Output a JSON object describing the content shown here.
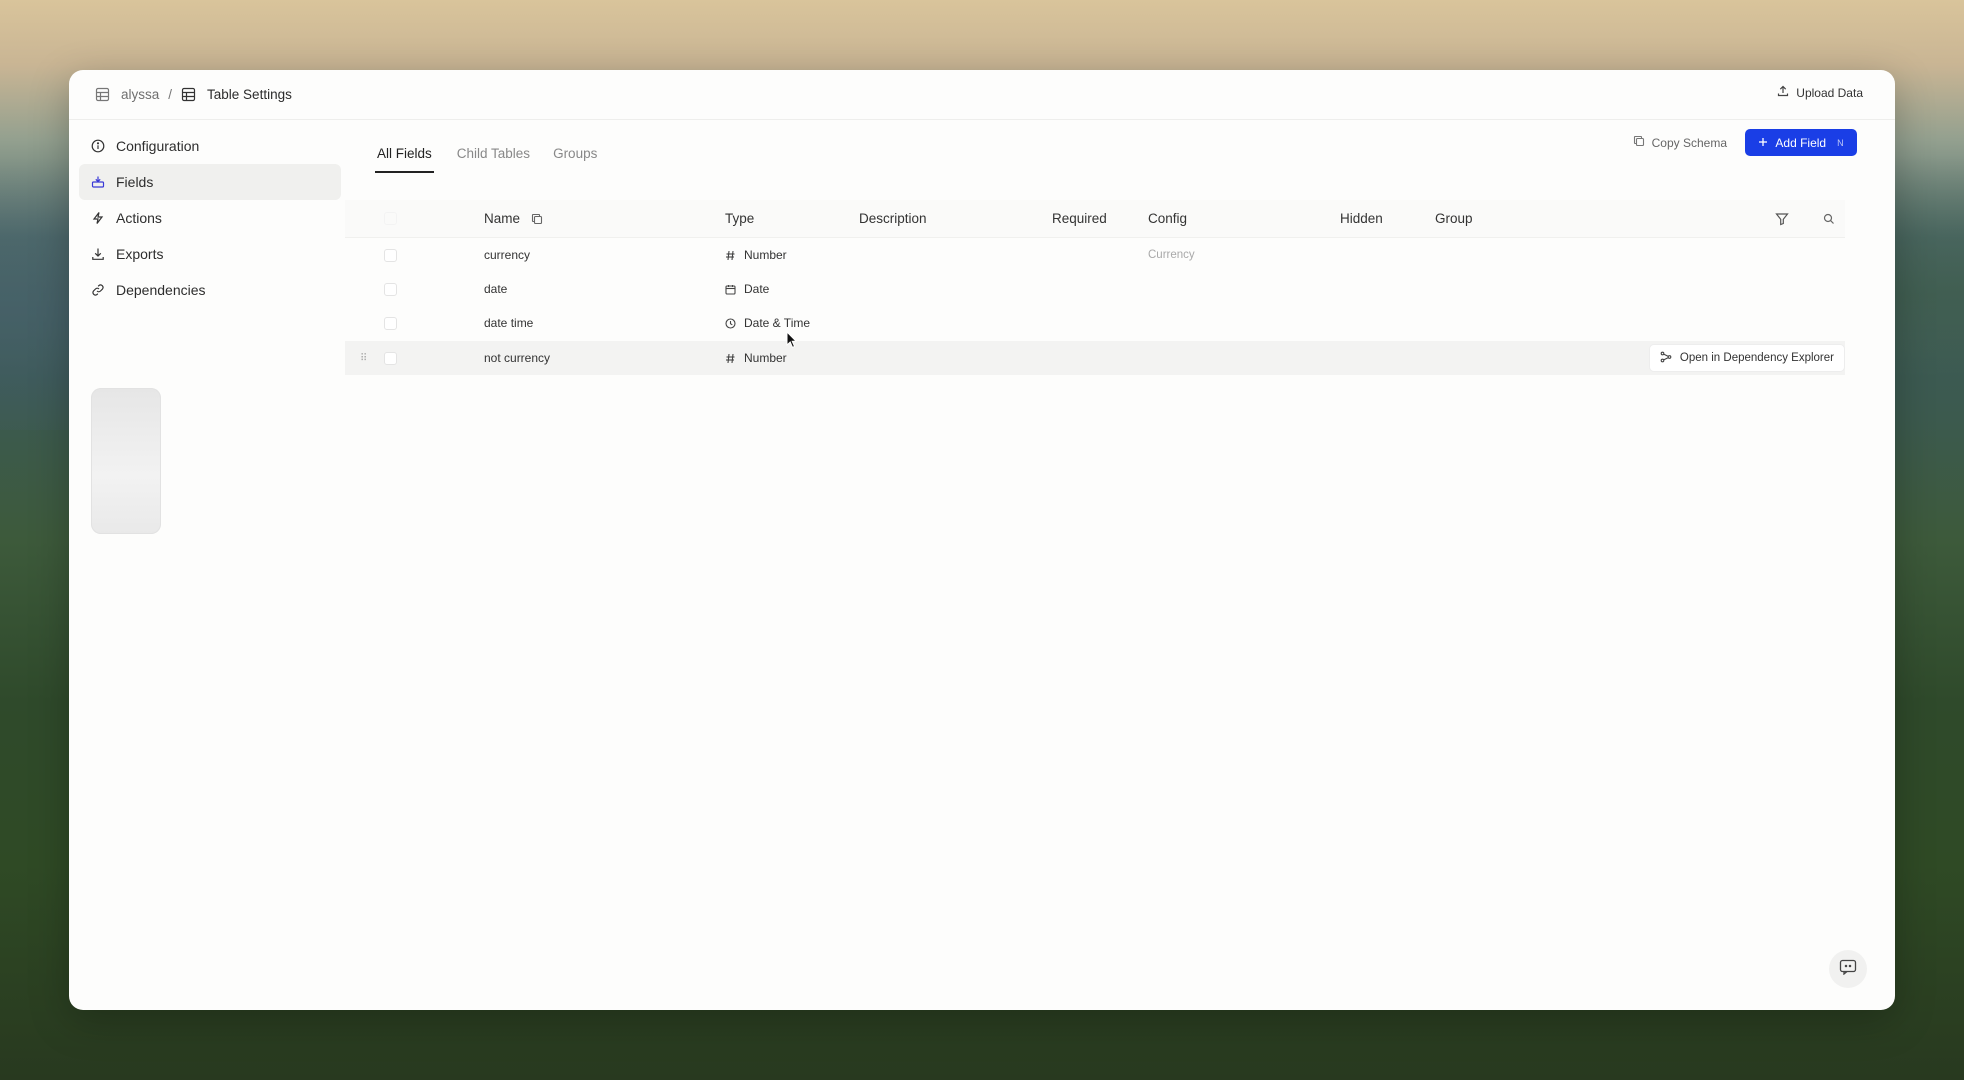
{
  "breadcrumb": {
    "workspace": "alyssa",
    "separator": "/",
    "page": "Table Settings"
  },
  "topbar": {
    "upload_label": "Upload Data"
  },
  "sidebar": {
    "items": [
      {
        "label": "Configuration",
        "icon": "info-circle-icon",
        "active": false
      },
      {
        "label": "Fields",
        "icon": "fields-icon",
        "active": true
      },
      {
        "label": "Actions",
        "icon": "lightning-icon",
        "active": false
      },
      {
        "label": "Exports",
        "icon": "download-icon",
        "active": false
      },
      {
        "label": "Dependencies",
        "icon": "link-icon",
        "active": false
      }
    ]
  },
  "tabs": [
    {
      "label": "All Fields",
      "active": true
    },
    {
      "label": "Child Tables",
      "active": false
    },
    {
      "label": "Groups",
      "active": false
    }
  ],
  "actions": {
    "copy_schema": "Copy Schema",
    "add_field": "Add Field",
    "add_field_shortcut": "N"
  },
  "columns": {
    "name": "Name",
    "type": "Type",
    "description": "Description",
    "required": "Required",
    "config": "Config",
    "hidden": "Hidden",
    "group": "Group"
  },
  "rows": [
    {
      "name": "currency",
      "type": "Number",
      "type_icon": "hash-icon",
      "config": "Currency"
    },
    {
      "name": "date",
      "type": "Date",
      "type_icon": "calendar-icon",
      "config": ""
    },
    {
      "name": "date time",
      "type": "Date & Time",
      "type_icon": "clock-icon",
      "config": ""
    },
    {
      "name": "not currency",
      "type": "Number",
      "type_icon": "hash-icon",
      "config": ""
    }
  ],
  "row_action": {
    "label": "Open in Dependency Explorer"
  },
  "colors": {
    "accent": "#1a3ee6",
    "active_nav_bg": "#f0f0ee"
  }
}
